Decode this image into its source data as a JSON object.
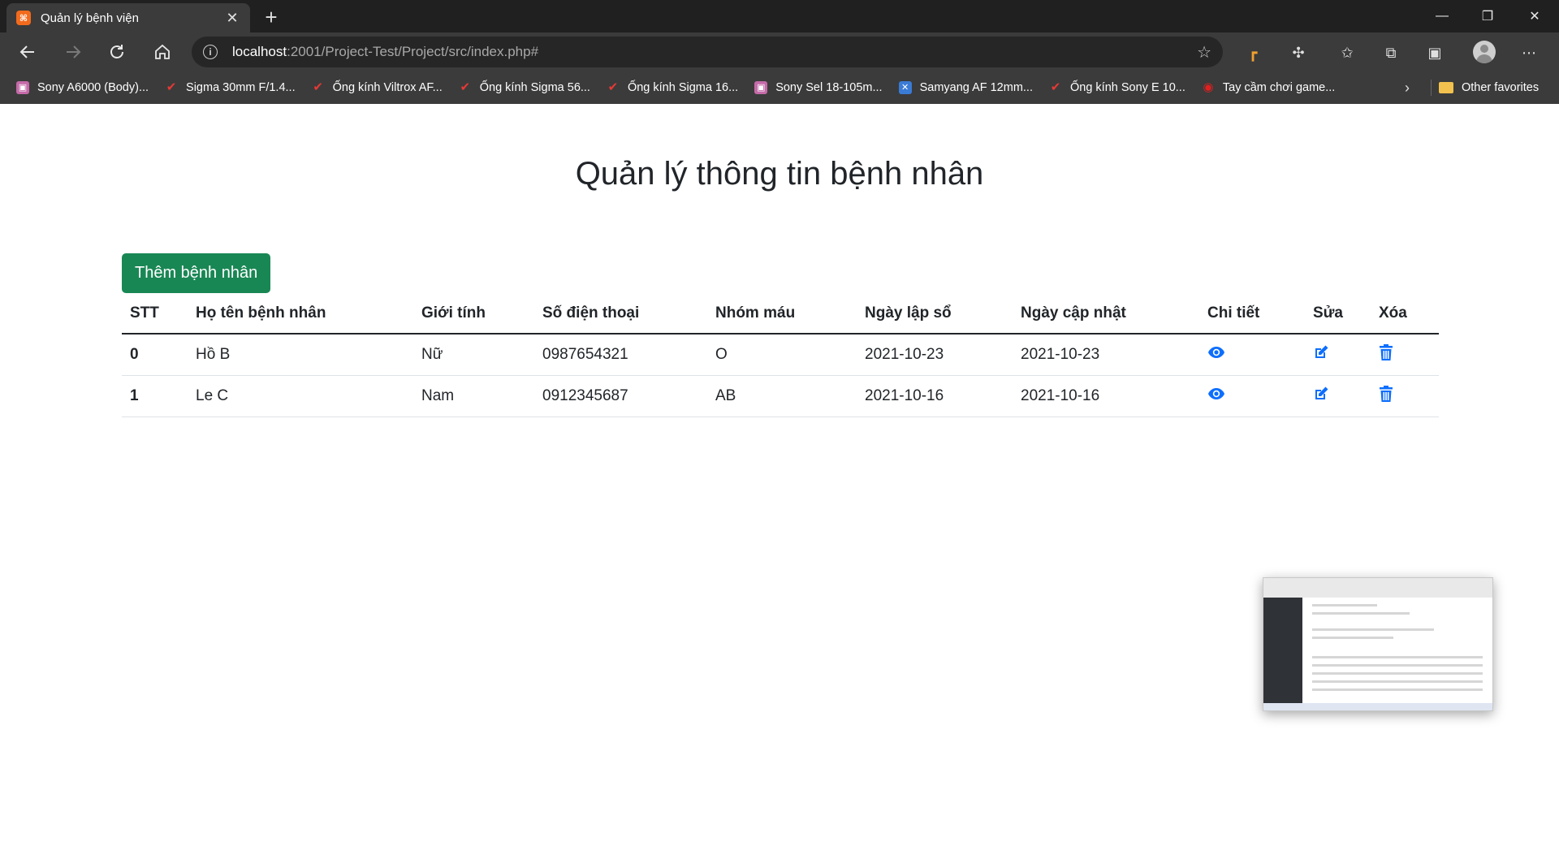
{
  "browser": {
    "tab_title": "Quản lý bệnh viện",
    "favicon_text": "⌘",
    "address_host": "localhost",
    "address_path": ":2001/Project-Test/Project/src/index.php#",
    "bookmarks": [
      {
        "label": "Sony A6000 (Body)...",
        "icon": "purple"
      },
      {
        "label": "Sigma 30mm F/1.4...",
        "icon": "red"
      },
      {
        "label": "Ống kính Viltrox AF...",
        "icon": "red"
      },
      {
        "label": "Ống kính Sigma 56...",
        "icon": "red"
      },
      {
        "label": "Ống kính Sigma 16...",
        "icon": "red"
      },
      {
        "label": "Sony Sel 18-105m...",
        "icon": "purple"
      },
      {
        "label": "Samyang AF 12mm...",
        "icon": "blue"
      },
      {
        "label": "Ống kính Sony E 10...",
        "icon": "red"
      },
      {
        "label": "Tay cầm chơi game...",
        "icon": "redring"
      }
    ],
    "other_favorites": "Other favorites"
  },
  "page": {
    "title": "Quản lý thông tin bệnh nhân",
    "add_button": "Thêm bệnh nhân"
  },
  "table": {
    "headers": [
      "STT",
      "Họ tên bệnh nhân",
      "Giới tính",
      "Số điện thoại",
      "Nhóm máu",
      "Ngày lập sổ",
      "Ngày cập nhật",
      "Chi tiết",
      "Sửa",
      "Xóa"
    ],
    "rows": [
      {
        "stt": "0",
        "name": "Hồ B",
        "gender": "Nữ",
        "phone": "0987654321",
        "blood": "O",
        "created": "2021-10-23",
        "updated": "2021-10-23"
      },
      {
        "stt": "1",
        "name": "Le C",
        "gender": "Nam",
        "phone": "0912345687",
        "blood": "AB",
        "created": "2021-10-16",
        "updated": "2021-10-16"
      }
    ]
  },
  "colors": {
    "accent_green": "#198754",
    "action_blue": "#0d6efd",
    "chrome_dark": "#202020"
  }
}
